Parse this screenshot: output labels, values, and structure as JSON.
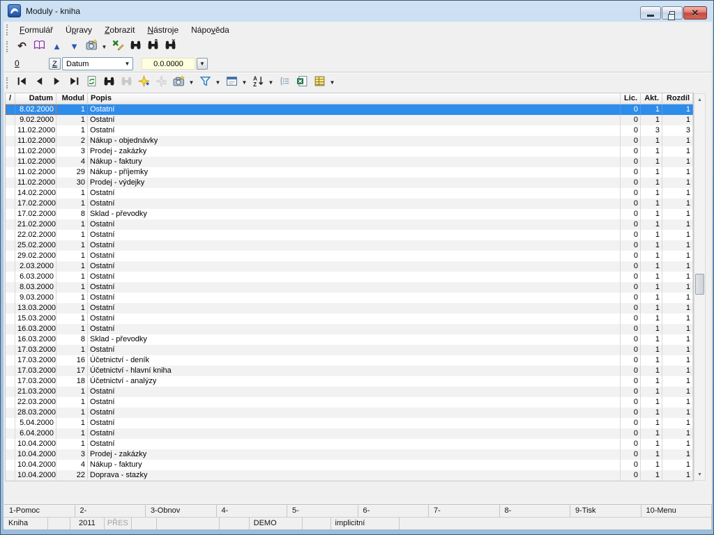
{
  "window": {
    "title": "Moduly - kniha",
    "controls": {
      "minimize": "minimize",
      "restore": "restore",
      "close": "close"
    }
  },
  "menu": {
    "items": [
      {
        "label": "Formulář",
        "hotkey": "F"
      },
      {
        "label": "Úpravy",
        "hotkey": "p"
      },
      {
        "label": "Zobrazit",
        "hotkey": "Z"
      },
      {
        "label": "Nástroje",
        "hotkey": "N"
      },
      {
        "label": "Nápověda",
        "hotkey": "v"
      }
    ]
  },
  "toolbar_main": {
    "buttons": [
      {
        "icon": "undo-icon"
      },
      {
        "icon": "book-icon"
      },
      {
        "icon": "arrow-up-icon"
      },
      {
        "icon": "arrow-down-icon"
      },
      {
        "icon": "camera-icon",
        "dropdown": true
      },
      {
        "icon": "edit-x-icon"
      },
      {
        "icon": "binoculars-icon"
      },
      {
        "icon": "binoculars-up-icon"
      },
      {
        "icon": "binoculars-next-icon"
      }
    ]
  },
  "filter_bar": {
    "index_label": "0",
    "z_button": "Z",
    "field_selector": {
      "value": "Datum"
    },
    "value_box": {
      "value": "0.0.0000"
    }
  },
  "toolbar_table": {
    "buttons": [
      {
        "icon": "nav-first-icon"
      },
      {
        "icon": "nav-prev-icon"
      },
      {
        "icon": "nav-next-icon"
      },
      {
        "icon": "nav-last-icon"
      },
      {
        "icon": "refresh-icon"
      },
      {
        "icon": "binoculars-icon"
      },
      {
        "icon": "binoculars-disabled-icon",
        "disabled": true
      },
      {
        "icon": "star-add-icon"
      },
      {
        "icon": "star-remove-icon",
        "disabled": true
      },
      {
        "icon": "camera-icon",
        "dropdown": true
      },
      {
        "icon": "filter-icon",
        "dropdown": true
      },
      {
        "icon": "form-icon",
        "dropdown": true
      },
      {
        "icon": "sort-az-icon",
        "dropdown": true
      },
      {
        "icon": "list-icon"
      },
      {
        "icon": "excel-icon"
      },
      {
        "icon": "grid-icon",
        "dropdown": true
      }
    ]
  },
  "table": {
    "sort_indicator": "/",
    "columns": [
      "",
      "Datum",
      "Modul",
      "Popis",
      "Lic.",
      "Akt.",
      "Rozdíl"
    ],
    "selected_row_index": 0,
    "rows": [
      [
        "8.02.2000",
        "1",
        "Ostatní",
        "0",
        "1",
        "1"
      ],
      [
        "9.02.2000",
        "1",
        "Ostatní",
        "0",
        "1",
        "1"
      ],
      [
        "11.02.2000",
        "1",
        "Ostatní",
        "0",
        "3",
        "3"
      ],
      [
        "11.02.2000",
        "2",
        "Nákup - objednávky",
        "0",
        "1",
        "1"
      ],
      [
        "11.02.2000",
        "3",
        "Prodej - zakázky",
        "0",
        "1",
        "1"
      ],
      [
        "11.02.2000",
        "4",
        "Nákup - faktury",
        "0",
        "1",
        "1"
      ],
      [
        "11.02.2000",
        "29",
        "Nákup - příjemky",
        "0",
        "1",
        "1"
      ],
      [
        "11.02.2000",
        "30",
        "Prodej - výdejky",
        "0",
        "1",
        "1"
      ],
      [
        "14.02.2000",
        "1",
        "Ostatní",
        "0",
        "1",
        "1"
      ],
      [
        "17.02.2000",
        "1",
        "Ostatní",
        "0",
        "1",
        "1"
      ],
      [
        "17.02.2000",
        "8",
        "Sklad - převodky",
        "0",
        "1",
        "1"
      ],
      [
        "21.02.2000",
        "1",
        "Ostatní",
        "0",
        "1",
        "1"
      ],
      [
        "22.02.2000",
        "1",
        "Ostatní",
        "0",
        "1",
        "1"
      ],
      [
        "25.02.2000",
        "1",
        "Ostatní",
        "0",
        "1",
        "1"
      ],
      [
        "29.02.2000",
        "1",
        "Ostatní",
        "0",
        "1",
        "1"
      ],
      [
        "2.03.2000",
        "1",
        "Ostatní",
        "0",
        "1",
        "1"
      ],
      [
        "6.03.2000",
        "1",
        "Ostatní",
        "0",
        "1",
        "1"
      ],
      [
        "8.03.2000",
        "1",
        "Ostatní",
        "0",
        "1",
        "1"
      ],
      [
        "9.03.2000",
        "1",
        "Ostatní",
        "0",
        "1",
        "1"
      ],
      [
        "13.03.2000",
        "1",
        "Ostatní",
        "0",
        "1",
        "1"
      ],
      [
        "15.03.2000",
        "1",
        "Ostatní",
        "0",
        "1",
        "1"
      ],
      [
        "16.03.2000",
        "1",
        "Ostatní",
        "0",
        "1",
        "1"
      ],
      [
        "16.03.2000",
        "8",
        "Sklad - převodky",
        "0",
        "1",
        "1"
      ],
      [
        "17.03.2000",
        "1",
        "Ostatní",
        "0",
        "1",
        "1"
      ],
      [
        "17.03.2000",
        "16",
        "Účetnictví - deník",
        "0",
        "1",
        "1"
      ],
      [
        "17.03.2000",
        "17",
        "Účetnictví - hlavní kniha",
        "0",
        "1",
        "1"
      ],
      [
        "17.03.2000",
        "18",
        "Účetnictví - analýzy",
        "0",
        "1",
        "1"
      ],
      [
        "21.03.2000",
        "1",
        "Ostatní",
        "0",
        "1",
        "1"
      ],
      [
        "22.03.2000",
        "1",
        "Ostatní",
        "0",
        "1",
        "1"
      ],
      [
        "28.03.2000",
        "1",
        "Ostatní",
        "0",
        "1",
        "1"
      ],
      [
        "5.04.2000",
        "1",
        "Ostatní",
        "0",
        "1",
        "1"
      ],
      [
        "6.04.2000",
        "1",
        "Ostatní",
        "0",
        "1",
        "1"
      ],
      [
        "10.04.2000",
        "1",
        "Ostatní",
        "0",
        "1",
        "1"
      ],
      [
        "10.04.2000",
        "3",
        "Prodej - zakázky",
        "0",
        "1",
        "1"
      ],
      [
        "10.04.2000",
        "4",
        "Nákup - faktury",
        "0",
        "1",
        "1"
      ],
      [
        "10.04.2000",
        "22",
        "Doprava - stazky",
        "0",
        "1",
        "1"
      ]
    ]
  },
  "fkeys": [
    "1-Pomoc",
    "2-",
    "3-Obnov",
    "4-",
    "5-",
    "6-",
    "7-",
    "8-",
    "9-Tisk",
    "10-Menu"
  ],
  "statusbar": {
    "cells": [
      {
        "text": "Kniha"
      },
      {
        "text": ""
      },
      {
        "text": "2011",
        "center": true
      },
      {
        "text": "PŘES",
        "center": true,
        "muted": true
      },
      {
        "text": ""
      },
      {
        "text": ""
      },
      {
        "text": ""
      },
      {
        "text": "DEMO"
      },
      {
        "text": ""
      },
      {
        "text": "implicitní"
      },
      {
        "text": ""
      }
    ]
  },
  "colors": {
    "selection": "#2e8ceb",
    "frame": "#a9c6e2",
    "close_button": "#c7473c",
    "value_field": "#ffffdf",
    "client_bg": "#f0f0f0"
  }
}
